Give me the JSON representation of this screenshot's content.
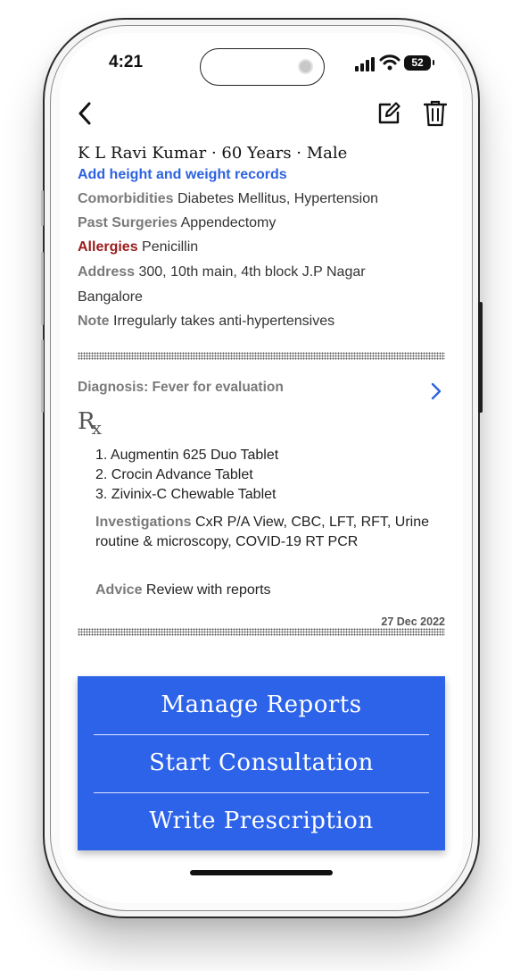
{
  "status_bar": {
    "time": "4:21",
    "battery": "52"
  },
  "toolbar": {
    "back_icon": "chevron-left-icon",
    "edit_icon": "edit-icon",
    "delete_icon": "trash-icon"
  },
  "patient": {
    "name_line": "K L Ravi Kumar · 60 Years · Male",
    "add_records_link": "Add height and weight records",
    "comorbidities": {
      "label": "Comorbidities",
      "value": "Diabetes Mellitus, Hypertension"
    },
    "past_surgeries": {
      "label": "Past Surgeries",
      "value": "Appendectomy"
    },
    "allergies": {
      "label": "Allergies",
      "value": "Penicillin"
    },
    "address": {
      "label": "Address",
      "value": "300, 10th main, 4th block J.P Nagar",
      "value_line2": "Bangalore"
    },
    "note": {
      "label": "Note",
      "value": "Irregularly takes anti-hypertensives"
    }
  },
  "consultation": {
    "diagnosis": "Diagnosis: Fever for evaluation",
    "rx_symbol": "R",
    "rx_sub": "x",
    "medications": [
      "1. Augmentin 625 Duo Tablet",
      "2. Crocin Advance Tablet",
      "3. Zivinix-C Chewable Tablet"
    ],
    "investigations": {
      "label": "Investigations",
      "value": "CxR P/A View, CBC, LFT, RFT, Urine routine & microscopy, COVID-19 RT PCR"
    },
    "advice": {
      "label": "Advice",
      "value": "Review with reports"
    },
    "date": "27 Dec 2022"
  },
  "actions": {
    "manage_reports": "Manage Reports",
    "start_consultation": "Start Consultation",
    "write_prescription": "Write Prescription"
  },
  "colors": {
    "accent_blue": "#2d63e8",
    "link_blue": "#2d62e0",
    "allergy_red": "#9a1c1c",
    "label_gray": "#7a7a7a"
  }
}
